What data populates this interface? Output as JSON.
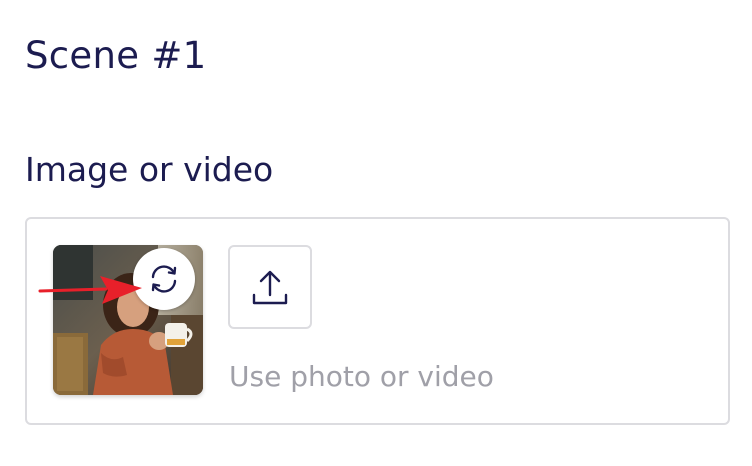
{
  "scene": {
    "title": "Scene #1"
  },
  "media": {
    "section_label": "Image or video",
    "upload_hint": "Use photo or video",
    "thumbnail_icon": "replace-icon",
    "upload_icon": "upload-icon"
  },
  "colors": {
    "title_text": "#1c1c50",
    "hint_text": "#a0a0a8",
    "border": "#dcdce0",
    "annotation_arrow": "#e8202a"
  }
}
